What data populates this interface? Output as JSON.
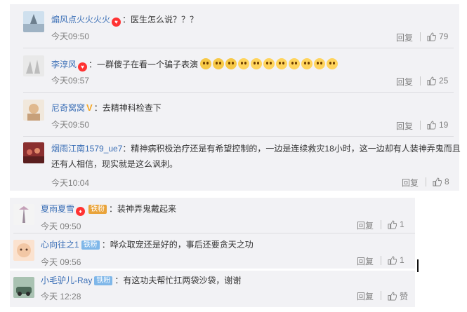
{
  "comments_a": [
    {
      "user": "煽风点火火火火",
      "text": "：医生怎么说？？？",
      "time": "今天09:50",
      "reply": "回复",
      "likes": "79"
    },
    {
      "user": "李淳风",
      "text": "：一群傻子在看一个骗子表演",
      "time": "今天09:57",
      "reply": "回复",
      "likes": "25"
    },
    {
      "user": "尼奇窝窝",
      "text": "：去精神科检查下",
      "time": "今天09:50",
      "reply": "回复",
      "likes": "19"
    },
    {
      "user": "烟雨江南1579_ue7",
      "text": "：精神病积极治疗还是有希望控制的，一边是连续救灾18小时，这一边却有人装神弄鬼而且还有人相信，现实就是这么讽刺。",
      "time": "今天10:04",
      "reply": "回复",
      "likes": "8"
    }
  ],
  "comments_b": [
    {
      "user": "夏雨夏雪",
      "badge": "铁粉",
      "text": "：装神弄鬼戴起来",
      "time": "今天 09:50",
      "reply": "回复",
      "likes": "1"
    },
    {
      "user": "心向往之1",
      "badge": "铁粉",
      "text": "：哗众取宠还是好的，事后还要贪天之功",
      "time": "今天 09:56",
      "reply": "回复",
      "likes": "1"
    }
  ],
  "comments_c": [
    {
      "user": "小毛驴儿-Ray",
      "badge": "铁粉",
      "text": "：有这功夫帮忙扛两袋沙袋，谢谢",
      "time": "今天 12:28",
      "reply": "回复",
      "likes": "赞"
    }
  ]
}
